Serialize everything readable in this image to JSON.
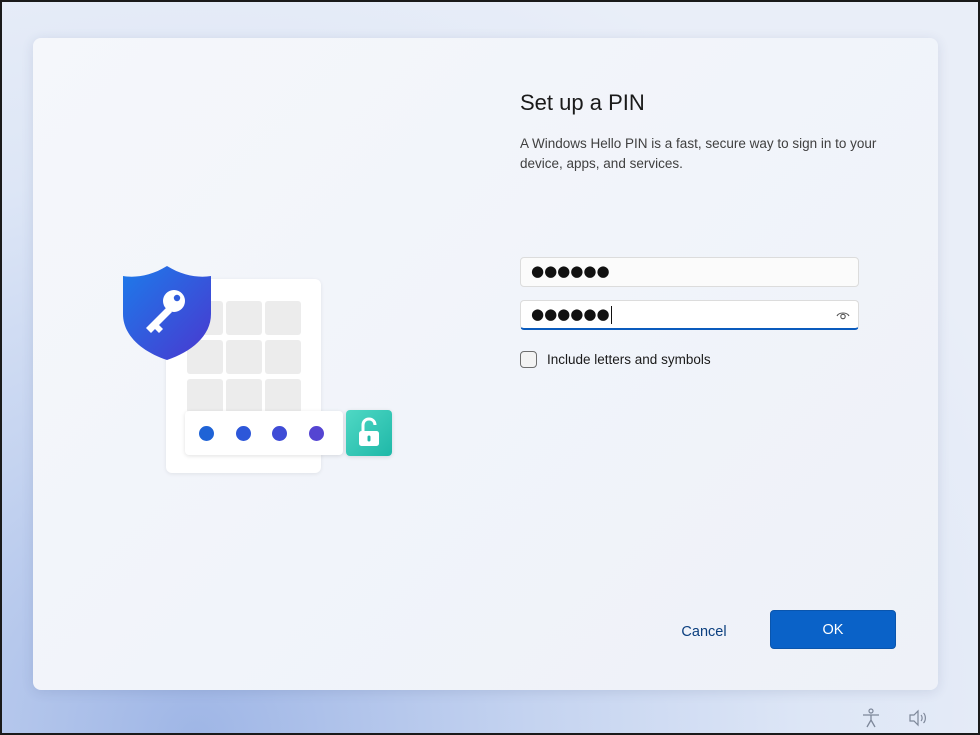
{
  "dialog": {
    "title": "Set up a PIN",
    "description": "A Windows Hello PIN is a fast, secure way to sign in to your device, apps, and services.",
    "pin_field": {
      "value": "●●●●●●",
      "masked": true
    },
    "confirm_pin_field": {
      "value": "●●●●●●",
      "masked": true,
      "focused": true,
      "reveal_icon": "eye-icon"
    },
    "include_letters_checkbox": {
      "label": "Include letters and symbols",
      "checked": false
    },
    "cancel_label": "Cancel",
    "ok_label": "OK"
  },
  "illustration": {
    "shield_icon": "key-shield-icon",
    "lock_icon": "unlocked-padlock-icon",
    "pin_dot_colors": [
      "#1f63d6",
      "#2d57d9",
      "#3f4cd6",
      "#5545d2"
    ],
    "accent": "#0a62c8"
  },
  "system_tray": {
    "accessibility_icon": "accessibility-icon",
    "volume_icon": "volume-icon"
  }
}
